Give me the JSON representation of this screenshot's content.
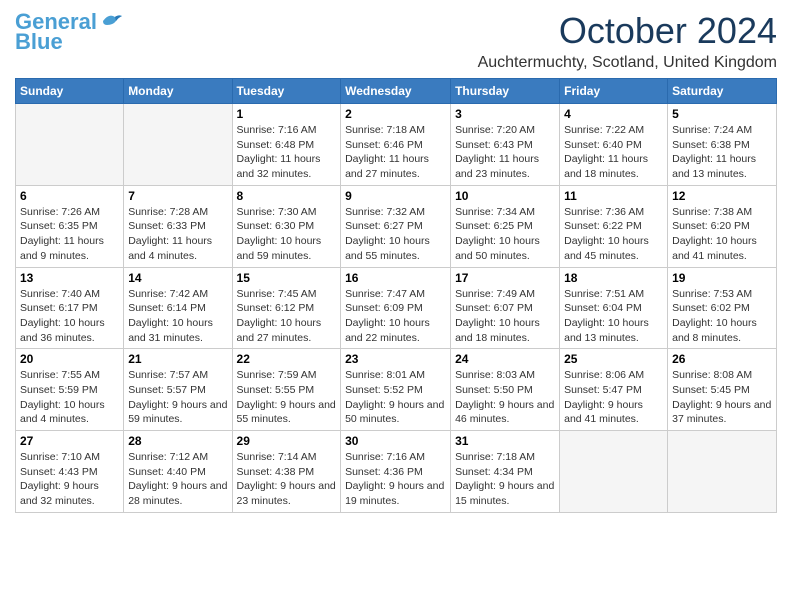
{
  "logo": {
    "line1": "General",
    "line2": "Blue"
  },
  "title": "October 2024",
  "location": "Auchtermuchty, Scotland, United Kingdom",
  "weekdays": [
    "Sunday",
    "Monday",
    "Tuesday",
    "Wednesday",
    "Thursday",
    "Friday",
    "Saturday"
  ],
  "weeks": [
    [
      {
        "day": "",
        "info": ""
      },
      {
        "day": "",
        "info": ""
      },
      {
        "day": "1",
        "info": "Sunrise: 7:16 AM\nSunset: 6:48 PM\nDaylight: 11 hours and 32 minutes."
      },
      {
        "day": "2",
        "info": "Sunrise: 7:18 AM\nSunset: 6:46 PM\nDaylight: 11 hours and 27 minutes."
      },
      {
        "day": "3",
        "info": "Sunrise: 7:20 AM\nSunset: 6:43 PM\nDaylight: 11 hours and 23 minutes."
      },
      {
        "day": "4",
        "info": "Sunrise: 7:22 AM\nSunset: 6:40 PM\nDaylight: 11 hours and 18 minutes."
      },
      {
        "day": "5",
        "info": "Sunrise: 7:24 AM\nSunset: 6:38 PM\nDaylight: 11 hours and 13 minutes."
      }
    ],
    [
      {
        "day": "6",
        "info": "Sunrise: 7:26 AM\nSunset: 6:35 PM\nDaylight: 11 hours and 9 minutes."
      },
      {
        "day": "7",
        "info": "Sunrise: 7:28 AM\nSunset: 6:33 PM\nDaylight: 11 hours and 4 minutes."
      },
      {
        "day": "8",
        "info": "Sunrise: 7:30 AM\nSunset: 6:30 PM\nDaylight: 10 hours and 59 minutes."
      },
      {
        "day": "9",
        "info": "Sunrise: 7:32 AM\nSunset: 6:27 PM\nDaylight: 10 hours and 55 minutes."
      },
      {
        "day": "10",
        "info": "Sunrise: 7:34 AM\nSunset: 6:25 PM\nDaylight: 10 hours and 50 minutes."
      },
      {
        "day": "11",
        "info": "Sunrise: 7:36 AM\nSunset: 6:22 PM\nDaylight: 10 hours and 45 minutes."
      },
      {
        "day": "12",
        "info": "Sunrise: 7:38 AM\nSunset: 6:20 PM\nDaylight: 10 hours and 41 minutes."
      }
    ],
    [
      {
        "day": "13",
        "info": "Sunrise: 7:40 AM\nSunset: 6:17 PM\nDaylight: 10 hours and 36 minutes."
      },
      {
        "day": "14",
        "info": "Sunrise: 7:42 AM\nSunset: 6:14 PM\nDaylight: 10 hours and 31 minutes."
      },
      {
        "day": "15",
        "info": "Sunrise: 7:45 AM\nSunset: 6:12 PM\nDaylight: 10 hours and 27 minutes."
      },
      {
        "day": "16",
        "info": "Sunrise: 7:47 AM\nSunset: 6:09 PM\nDaylight: 10 hours and 22 minutes."
      },
      {
        "day": "17",
        "info": "Sunrise: 7:49 AM\nSunset: 6:07 PM\nDaylight: 10 hours and 18 minutes."
      },
      {
        "day": "18",
        "info": "Sunrise: 7:51 AM\nSunset: 6:04 PM\nDaylight: 10 hours and 13 minutes."
      },
      {
        "day": "19",
        "info": "Sunrise: 7:53 AM\nSunset: 6:02 PM\nDaylight: 10 hours and 8 minutes."
      }
    ],
    [
      {
        "day": "20",
        "info": "Sunrise: 7:55 AM\nSunset: 5:59 PM\nDaylight: 10 hours and 4 minutes."
      },
      {
        "day": "21",
        "info": "Sunrise: 7:57 AM\nSunset: 5:57 PM\nDaylight: 9 hours and 59 minutes."
      },
      {
        "day": "22",
        "info": "Sunrise: 7:59 AM\nSunset: 5:55 PM\nDaylight: 9 hours and 55 minutes."
      },
      {
        "day": "23",
        "info": "Sunrise: 8:01 AM\nSunset: 5:52 PM\nDaylight: 9 hours and 50 minutes."
      },
      {
        "day": "24",
        "info": "Sunrise: 8:03 AM\nSunset: 5:50 PM\nDaylight: 9 hours and 46 minutes."
      },
      {
        "day": "25",
        "info": "Sunrise: 8:06 AM\nSunset: 5:47 PM\nDaylight: 9 hours and 41 minutes."
      },
      {
        "day": "26",
        "info": "Sunrise: 8:08 AM\nSunset: 5:45 PM\nDaylight: 9 hours and 37 minutes."
      }
    ],
    [
      {
        "day": "27",
        "info": "Sunrise: 7:10 AM\nSunset: 4:43 PM\nDaylight: 9 hours and 32 minutes."
      },
      {
        "day": "28",
        "info": "Sunrise: 7:12 AM\nSunset: 4:40 PM\nDaylight: 9 hours and 28 minutes."
      },
      {
        "day": "29",
        "info": "Sunrise: 7:14 AM\nSunset: 4:38 PM\nDaylight: 9 hours and 23 minutes."
      },
      {
        "day": "30",
        "info": "Sunrise: 7:16 AM\nSunset: 4:36 PM\nDaylight: 9 hours and 19 minutes."
      },
      {
        "day": "31",
        "info": "Sunrise: 7:18 AM\nSunset: 4:34 PM\nDaylight: 9 hours and 15 minutes."
      },
      {
        "day": "",
        "info": ""
      },
      {
        "day": "",
        "info": ""
      }
    ]
  ]
}
